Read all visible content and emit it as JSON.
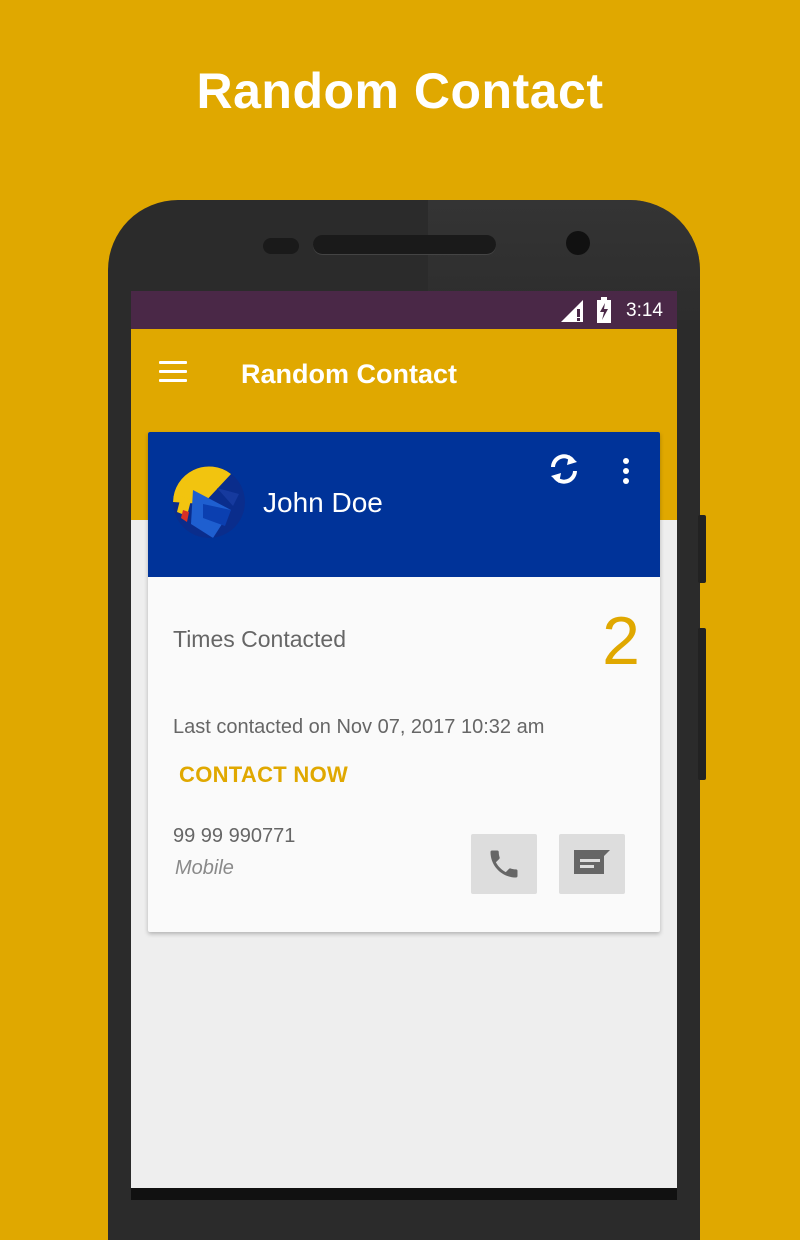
{
  "promo": {
    "title": "Random Contact"
  },
  "status_bar": {
    "time": "3:14"
  },
  "app_bar": {
    "title": "Random Contact"
  },
  "icons": {
    "menu": "hamburger-menu-icon",
    "refresh": "refresh-icon",
    "more": "more-vert-icon",
    "call": "phone-icon",
    "message": "message-icon",
    "signal": "signal-icon",
    "battery": "battery-charging-icon"
  },
  "contact": {
    "name": "John Doe",
    "times_contacted_label": "Times Contacted",
    "times_contacted_value": "2",
    "last_contacted": "Last contacted on  Nov 07, 2017 10:32 am",
    "contact_now_label": "CONTACT NOW",
    "phone_number": "99 99 990771",
    "phone_type": "Mobile"
  },
  "colors": {
    "accent": "#E0A800",
    "header_blue": "#003399",
    "status_bar": "#4A2847"
  }
}
